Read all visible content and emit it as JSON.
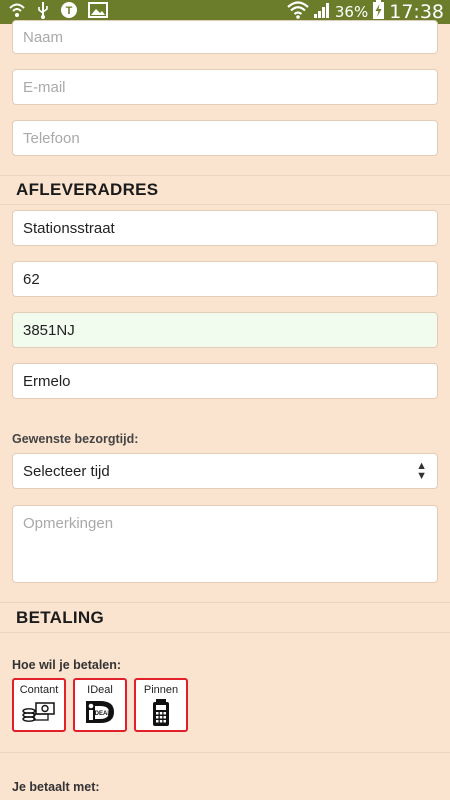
{
  "status_bar": {
    "battery": "36%",
    "time": "17:38",
    "icons": [
      "wifi-usb-icon",
      "usb-icon",
      "talk-icon",
      "image-icon",
      "wifi-signal-icon",
      "cell-signal-icon",
      "battery-charging-icon"
    ]
  },
  "contact": {
    "name_placeholder": "Naam",
    "email_placeholder": "E-mail",
    "phone_placeholder": "Telefoon"
  },
  "address": {
    "title": "AFLEVERADRES",
    "street": "Stationsstraat",
    "number": "62",
    "postcode": "3851NJ",
    "city": "Ermelo"
  },
  "delivery": {
    "label": "Gewenste bezorgtijd:",
    "select_value": "Selecteer tijd",
    "remarks_placeholder": "Opmerkingen"
  },
  "payment": {
    "title": "BETALING",
    "question": "Hoe wil je betalen:",
    "options": [
      {
        "label": "Contant",
        "icon": "cash-icon"
      },
      {
        "label": "IDeal",
        "icon": "ideal-icon"
      },
      {
        "label": "Pinnen",
        "icon": "pin-terminal-icon"
      }
    ],
    "pay_with_label": "Je betaalt met:"
  },
  "colors": {
    "background": "#fae3cf",
    "statusbar": "#6b7d2a",
    "accent_border": "#e0202a",
    "valid_field": "#f1fcef"
  }
}
